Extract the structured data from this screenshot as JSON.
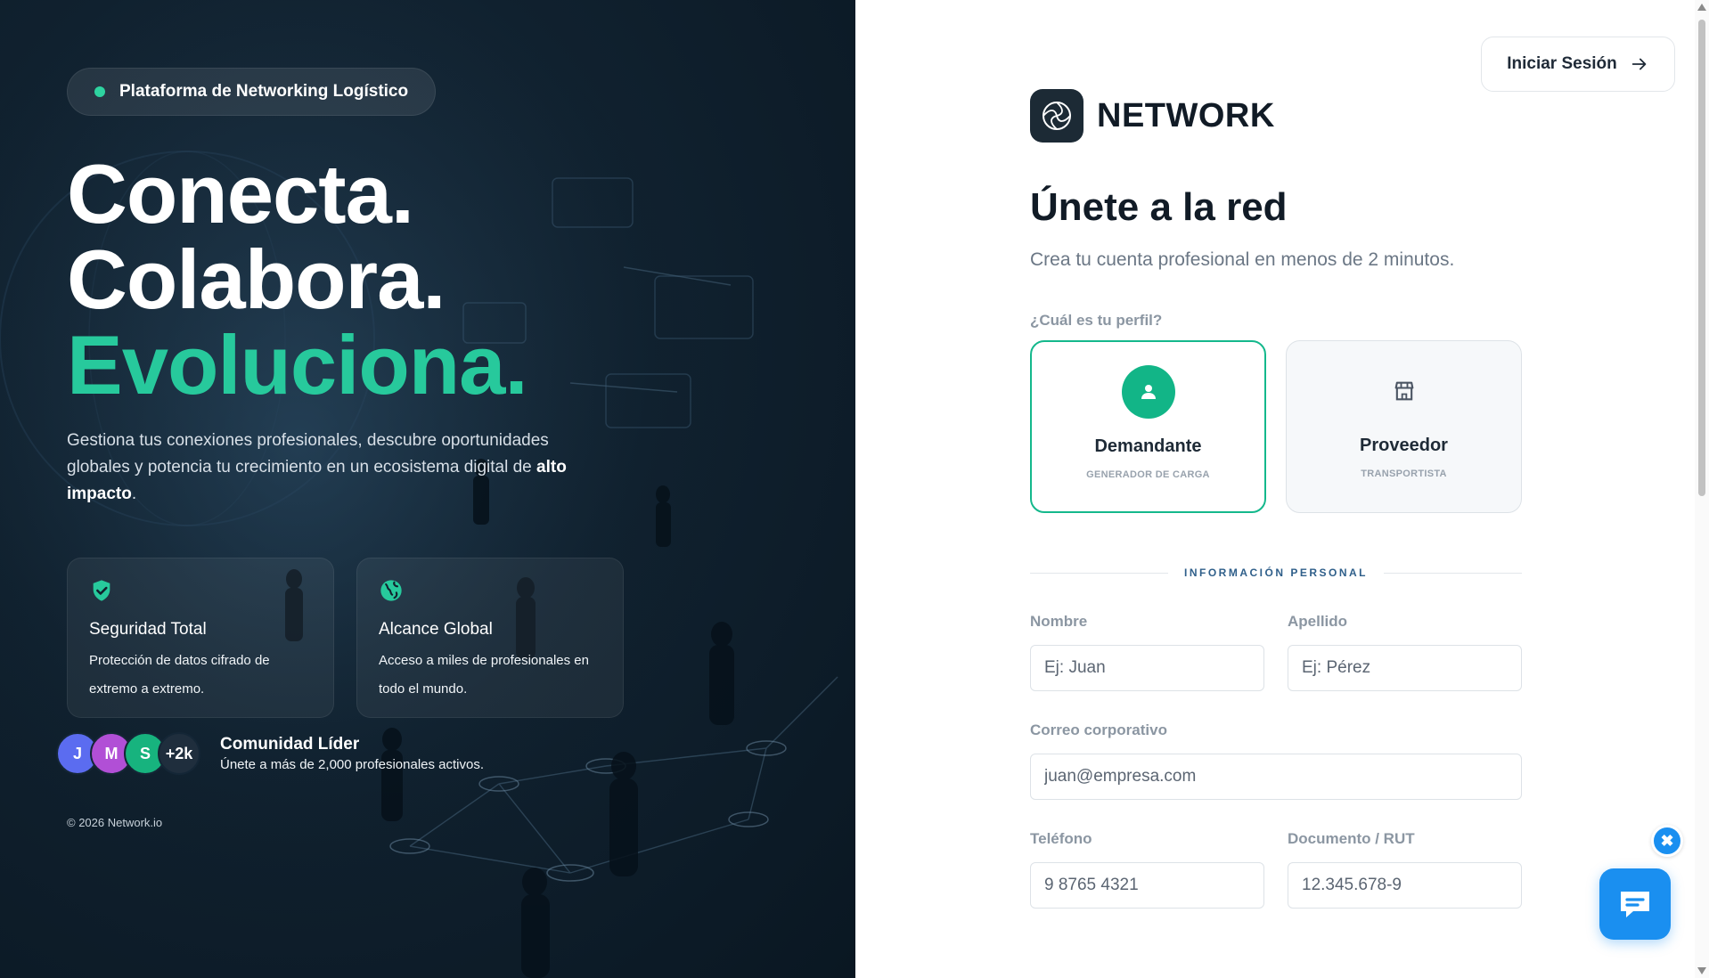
{
  "hero": {
    "badge": "Plataforma de Networking Logístico",
    "headline_line1": "Conecta.",
    "headline_line2": "Colabora.",
    "headline_line3": "Evoluciona.",
    "lead_text": "Gestiona tus conexiones profesionales, descubre oportunidades globales y potencia tu crecimiento en un ecosistema digital de ",
    "lead_bold": "alto impacto",
    "lead_end": ".",
    "features": [
      {
        "icon": "shield-check-icon",
        "title": "Seguridad Total",
        "desc": "Protección de datos cifrado de extremo a extremo."
      },
      {
        "icon": "globe-icon",
        "title": "Alcance Global",
        "desc": "Acceso a miles de profesionales en todo el mundo."
      }
    ],
    "avatars": [
      {
        "label": "J",
        "color": "#5b6cf0"
      },
      {
        "label": "M",
        "color": "#b14fd6"
      },
      {
        "label": "S",
        "color": "#17b37e"
      },
      {
        "label": "+2k",
        "color": "#1f2e3d"
      }
    ],
    "community_title": "Comunidad Líder",
    "community_sub": "Únete a más de 2,000 profesionales activos.",
    "copyright": "© 2026 Network.io"
  },
  "header": {
    "login_label": "Iniciar Sesión",
    "brand_name": "NETWORK"
  },
  "form": {
    "title": "Únete a la red",
    "subtitle": "Crea tu cuenta profesional en menos de 2 minutos.",
    "profile_question": "¿Cuál es tu perfil?",
    "profiles": [
      {
        "title": "Demandante",
        "sub": "GENERADOR DE CARGA",
        "selected": true
      },
      {
        "title": "Proveedor",
        "sub": "TRANSPORTISTA",
        "selected": false
      }
    ],
    "section_personal": "INFORMACIÓN PERSONAL",
    "fields": {
      "first_name": {
        "label": "Nombre",
        "placeholder": "Ej: Juan"
      },
      "last_name": {
        "label": "Apellido",
        "placeholder": "Ej: Pérez"
      },
      "email": {
        "label": "Correo corporativo",
        "placeholder": "juan@empresa.com"
      },
      "phone": {
        "label": "Teléfono",
        "placeholder": "9 8765 4321"
      },
      "document": {
        "label": "Documento / RUT",
        "placeholder": "12.345.678-9"
      }
    }
  },
  "chat": {
    "close_glyph": "✖"
  },
  "colors": {
    "accent_green": "#27c99c",
    "selected_border": "#14b88c",
    "chat_blue": "#1a8ff0",
    "hero_bg": "#10212f"
  }
}
